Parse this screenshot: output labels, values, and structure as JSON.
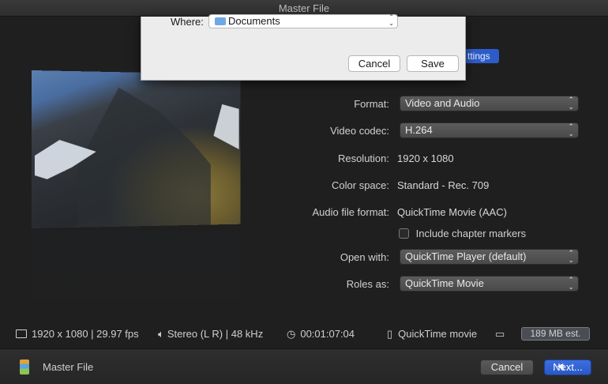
{
  "window": {
    "title": "Master File"
  },
  "save_sheet": {
    "where_label": "Where:",
    "where_value": "Documents",
    "cancel_label": "Cancel",
    "save_label": "Save"
  },
  "settings_tab": {
    "label": "ttings"
  },
  "form": {
    "format": {
      "label": "Format:",
      "value": "Video and Audio"
    },
    "video_codec": {
      "label": "Video codec:",
      "value": "H.264"
    },
    "resolution": {
      "label": "Resolution:",
      "value": "1920 x 1080"
    },
    "color_space": {
      "label": "Color space:",
      "value": "Standard - Rec. 709"
    },
    "audio_file_format": {
      "label": "Audio file format:",
      "value": "QuickTime Movie (AAC)"
    },
    "chapter_markers": {
      "label": "Include chapter markers",
      "checked": false
    },
    "open_with": {
      "label": "Open with:",
      "value": "QuickTime Player (default)"
    },
    "roles_as": {
      "label": "Roles as:",
      "value": "QuickTime Movie"
    }
  },
  "info_bar": {
    "video": "1920 x 1080 | 29.97 fps",
    "audio": "Stereo (L R) | 48 kHz",
    "duration": "00:01:07:04",
    "file_type": "QuickTime movie",
    "size_estimate": "189 MB est."
  },
  "bottom_bar": {
    "label": "Master File",
    "cancel_label": "Cancel",
    "next_label": "Next..."
  },
  "colors": {
    "accent": "#2d5cc9",
    "background": "#1f1f1f",
    "sheet": "#ececec"
  }
}
